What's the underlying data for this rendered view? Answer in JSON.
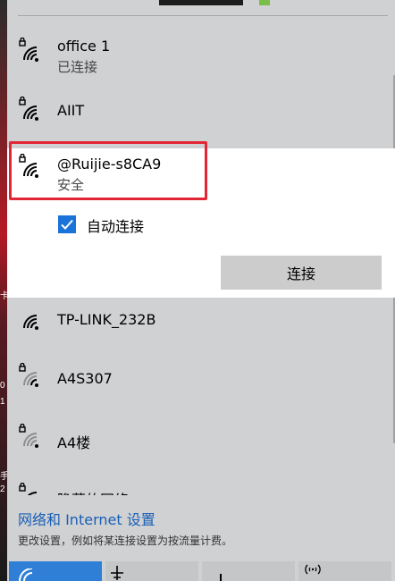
{
  "background_strip": {
    "fragments": [
      "卡",
      "0",
      "1",
      "手",
      "2"
    ]
  },
  "networks": [
    {
      "name": "office 1",
      "status": "已连接"
    },
    {
      "name": "AIIT",
      "status": ""
    },
    {
      "name": "@Ruijie-s8CA9",
      "status": "安全"
    },
    {
      "name": "TP-LINK_232B",
      "status": ""
    },
    {
      "name": "A4S307",
      "status": ""
    },
    {
      "name": "A4楼",
      "status": ""
    },
    {
      "name": "隐藏的网络",
      "status": ""
    }
  ],
  "expanded": {
    "auto_connect_label": "自动连接",
    "auto_connect_checked": true,
    "connect_button": "连接"
  },
  "footer": {
    "settings_link": "网络和 Internet 设置",
    "settings_desc": "更改设置，例如将某连接设置为按流量计费。"
  },
  "colors": {
    "accent": "#1a73d9",
    "link": "#1a5fb4",
    "highlight": "#e32635",
    "panel": "#cfd1d3"
  }
}
